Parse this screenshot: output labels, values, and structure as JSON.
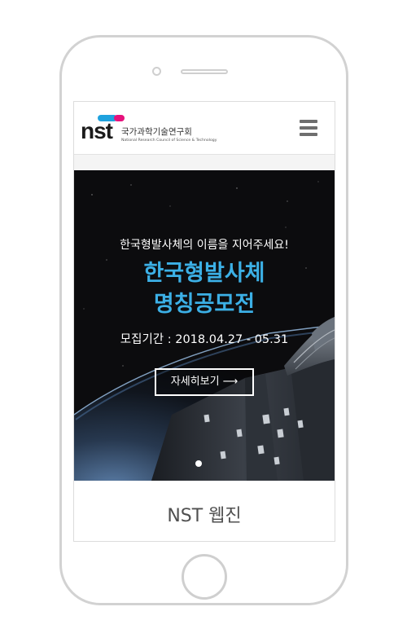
{
  "header": {
    "logo": {
      "mark": "nst",
      "org_name": "국가과학기술연구회",
      "org_name_en": "National Research Council of Science & Technology"
    },
    "menu_icon": "hamburger-menu-icon"
  },
  "banner": {
    "subtitle": "한국형발사체의 이름을 지어주세요!",
    "title_line1": "한국형발사체",
    "title_line2": "명칭공모전",
    "period": "모집기간 : 2018.04.27 - 05.31",
    "button_label": "자세히보기",
    "button_arrow": "⟶",
    "slide_count": 1,
    "active_slide": 1
  },
  "section": {
    "title": "NST 웹진"
  },
  "colors": {
    "accent_blue": "#3cb0e6",
    "logo_blue": "#1fa2de",
    "logo_pink": "#e6127c",
    "banner_bg": "#0c0c0e"
  }
}
